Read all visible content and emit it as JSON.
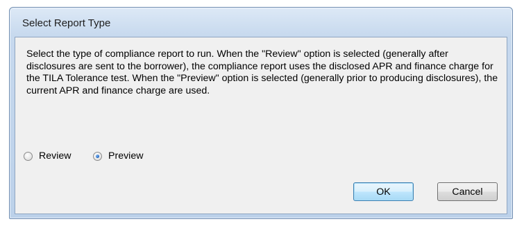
{
  "window": {
    "title": "Select Report Type"
  },
  "dialog": {
    "description": "Select the type of compliance report to run.  When the \"Review\" option is selected (generally after disclosures are sent to the borrower), the compliance report uses the disclosed APR and finance charge for the TILA Tolerance test.  When the \"Preview\" option is selected (generally prior to producing disclosures), the current APR and finance charge are used.",
    "options": [
      {
        "label": "Review",
        "checked": false
      },
      {
        "label": "Preview",
        "checked": true
      }
    ],
    "selected": "Preview"
  },
  "buttons": {
    "ok_label": "OK",
    "cancel_label": "Cancel"
  },
  "colors": {
    "title_bar": "#c7d9ee",
    "client_background": "#f0f0f0",
    "radio_selected_dot": "#2a6fc9",
    "default_button_border": "#3c7fb1"
  }
}
